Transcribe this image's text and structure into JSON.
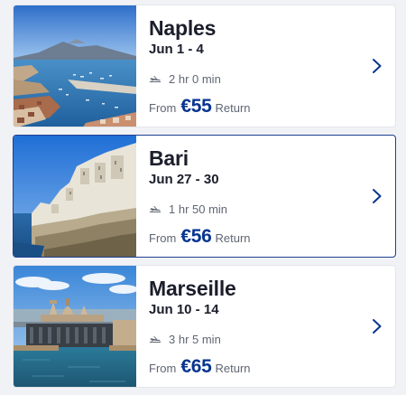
{
  "colors": {
    "accent": "#073590",
    "text": "#1b1e2b",
    "muted": "#5f6673",
    "selected_border": "#1f3f8f"
  },
  "cards": [
    {
      "city": "Naples",
      "dates": "Jun 1 - 4",
      "duration": "2 hr 0 min",
      "from": "From",
      "price": "€55",
      "fare_type": "Return",
      "selected": false
    },
    {
      "city": "Bari",
      "dates": "Jun 27 - 30",
      "duration": "1 hr 50 min",
      "from": "From",
      "price": "€56",
      "fare_type": "Return",
      "selected": true
    },
    {
      "city": "Marseille",
      "dates": "Jun 10 - 14",
      "duration": "3 hr 5 min",
      "from": "From",
      "price": "€65",
      "fare_type": "Return",
      "selected": false
    }
  ],
  "icons": {
    "duration": "plane-icon",
    "open": "chevron-right-icon"
  }
}
